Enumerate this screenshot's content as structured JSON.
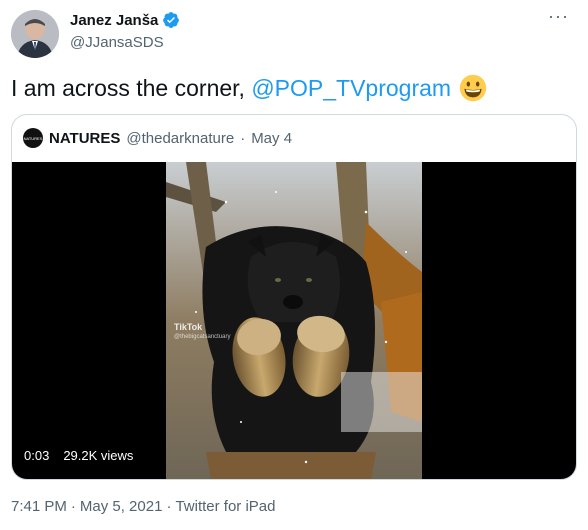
{
  "tweet": {
    "display_name": "Janez Janša",
    "handle": "@JJansaSDS",
    "text_prefix": "I am across the corner, ",
    "mention": "@POP_TVprogram",
    "emoji": "grinning-face-emoji",
    "more_label": "···",
    "verified": true
  },
  "quote": {
    "avatar_text": "NATURES",
    "name": "NATURES",
    "handle": "@thedarknature",
    "separator": "·",
    "date": "May 4",
    "video": {
      "watermark": "TikTok",
      "watermark_user": "@thebigcatsanctuary",
      "duration": "0:03",
      "views": "29.2K views"
    }
  },
  "meta": {
    "time": "7:41 PM",
    "sep1": "·",
    "date": "May 5, 2021",
    "sep2": "·",
    "source": "Twitter for iPad"
  },
  "colors": {
    "accent": "#1d9bf0",
    "text": "#0f1419",
    "secondary": "#536471",
    "border": "#cfd9de"
  }
}
